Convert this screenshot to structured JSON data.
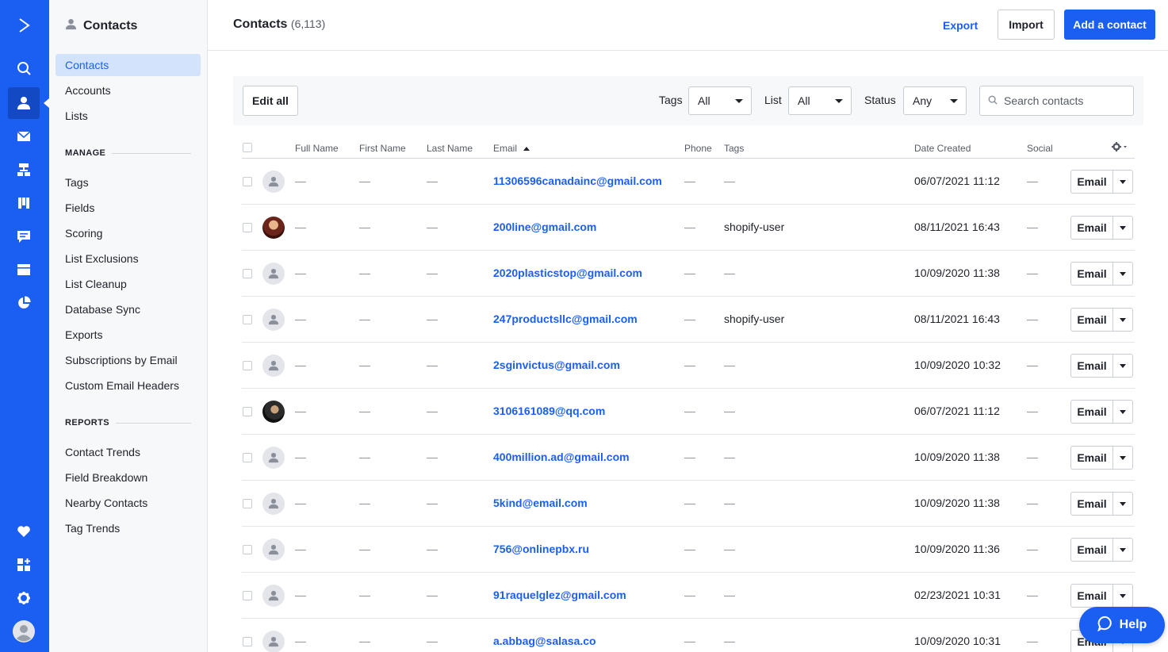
{
  "nav_rail": {
    "items": [
      {
        "name": "brand-logo",
        "icon": "chevron-right-logo-icon"
      },
      {
        "name": "search",
        "icon": "search-icon"
      },
      {
        "name": "contacts",
        "icon": "person-icon",
        "active": true
      },
      {
        "name": "campaigns",
        "icon": "envelope-icon"
      },
      {
        "name": "automations",
        "icon": "sitemap-icon"
      },
      {
        "name": "deals",
        "icon": "pipeline-icon"
      },
      {
        "name": "conversations",
        "icon": "chat-icon"
      },
      {
        "name": "website",
        "icon": "browser-icon"
      },
      {
        "name": "reports",
        "icon": "pie-chart-icon"
      },
      {
        "name": "favorites",
        "icon": "heart-icon"
      },
      {
        "name": "apps",
        "icon": "apps-plus-icon"
      },
      {
        "name": "settings",
        "icon": "gear-icon"
      },
      {
        "name": "user",
        "icon": "user-avatar-icon"
      }
    ]
  },
  "sidebar": {
    "title": "Contacts",
    "primary_items": [
      {
        "label": "Contacts",
        "active": true
      },
      {
        "label": "Accounts"
      },
      {
        "label": "Lists"
      }
    ],
    "manage_heading": "MANAGE",
    "manage_items": [
      {
        "label": "Tags"
      },
      {
        "label": "Fields"
      },
      {
        "label": "Scoring"
      },
      {
        "label": "List Exclusions"
      },
      {
        "label": "List Cleanup"
      },
      {
        "label": "Database Sync"
      },
      {
        "label": "Exports"
      },
      {
        "label": "Subscriptions by Email"
      },
      {
        "label": "Custom Email Headers"
      }
    ],
    "reports_heading": "REPORTS",
    "reports_items": [
      {
        "label": "Contact Trends"
      },
      {
        "label": "Field Breakdown"
      },
      {
        "label": "Nearby Contacts"
      },
      {
        "label": "Tag Trends"
      }
    ]
  },
  "header": {
    "title": "Contacts",
    "count": "(6,113)",
    "export_label": "Export",
    "import_label": "Import",
    "add_label": "Add a contact"
  },
  "filters": {
    "edit_all_label": "Edit all",
    "tags_label": "Tags",
    "tags_value": "All",
    "list_label": "List",
    "list_value": "All",
    "status_label": "Status",
    "status_value": "Any",
    "search_placeholder": "Search contacts"
  },
  "table": {
    "columns": {
      "full_name": "Full Name",
      "first_name": "First Name",
      "last_name": "Last Name",
      "email": "Email",
      "phone": "Phone",
      "tags": "Tags",
      "date_created": "Date Created",
      "social": "Social"
    },
    "action_label": "Email",
    "rows": [
      {
        "avatar": "default",
        "full_name": "—",
        "first_name": "—",
        "last_name": "—",
        "email": "11306596canadainc@gmail.com",
        "phone": "—",
        "tags": "—",
        "date_created": "06/07/2021 11:12",
        "social": "—"
      },
      {
        "avatar": "photo1",
        "full_name": "—",
        "first_name": "—",
        "last_name": "—",
        "email": "200line@gmail.com",
        "phone": "—",
        "tags": "shopify-user",
        "date_created": "08/11/2021 16:43",
        "social": "—"
      },
      {
        "avatar": "default",
        "full_name": "—",
        "first_name": "—",
        "last_name": "—",
        "email": "2020plasticstop@gmail.com",
        "phone": "—",
        "tags": "—",
        "date_created": "10/09/2020 11:38",
        "social": "—"
      },
      {
        "avatar": "default",
        "full_name": "—",
        "first_name": "—",
        "last_name": "—",
        "email": "247productsllc@gmail.com",
        "phone": "—",
        "tags": "shopify-user",
        "date_created": "08/11/2021 16:43",
        "social": "—"
      },
      {
        "avatar": "default",
        "full_name": "—",
        "first_name": "—",
        "last_name": "—",
        "email": "2sginvictus@gmail.com",
        "phone": "—",
        "tags": "—",
        "date_created": "10/09/2020 10:32",
        "social": "—"
      },
      {
        "avatar": "photo2",
        "full_name": "—",
        "first_name": "—",
        "last_name": "—",
        "email": "3106161089@qq.com",
        "phone": "—",
        "tags": "—",
        "date_created": "06/07/2021 11:12",
        "social": "—"
      },
      {
        "avatar": "default",
        "full_name": "—",
        "first_name": "—",
        "last_name": "—",
        "email": "400million.ad@gmail.com",
        "phone": "—",
        "tags": "—",
        "date_created": "10/09/2020 11:38",
        "social": "—"
      },
      {
        "avatar": "default",
        "full_name": "—",
        "first_name": "—",
        "last_name": "—",
        "email": "5kind@email.com",
        "phone": "—",
        "tags": "—",
        "date_created": "10/09/2020 11:38",
        "social": "—"
      },
      {
        "avatar": "default",
        "full_name": "—",
        "first_name": "—",
        "last_name": "—",
        "email": "756@onlinepbx.ru",
        "phone": "—",
        "tags": "—",
        "date_created": "10/09/2020 11:36",
        "social": "—"
      },
      {
        "avatar": "default",
        "full_name": "—",
        "first_name": "—",
        "last_name": "—",
        "email": "91raquelglez@gmail.com",
        "phone": "—",
        "tags": "—",
        "date_created": "02/23/2021 10:31",
        "social": "—"
      },
      {
        "avatar": "default",
        "full_name": "—",
        "first_name": "—",
        "last_name": "—",
        "email": "a.abbag@salasa.co",
        "phone": "—",
        "tags": "—",
        "date_created": "10/09/2020 10:31",
        "social": "—"
      }
    ]
  },
  "help": {
    "label": "Help"
  },
  "colors": {
    "brand": "#1b5ff2",
    "rail_active": "#1449c4",
    "sidebar_bg": "#f7f8fa",
    "active_item_bg": "#d4e3fc"
  }
}
